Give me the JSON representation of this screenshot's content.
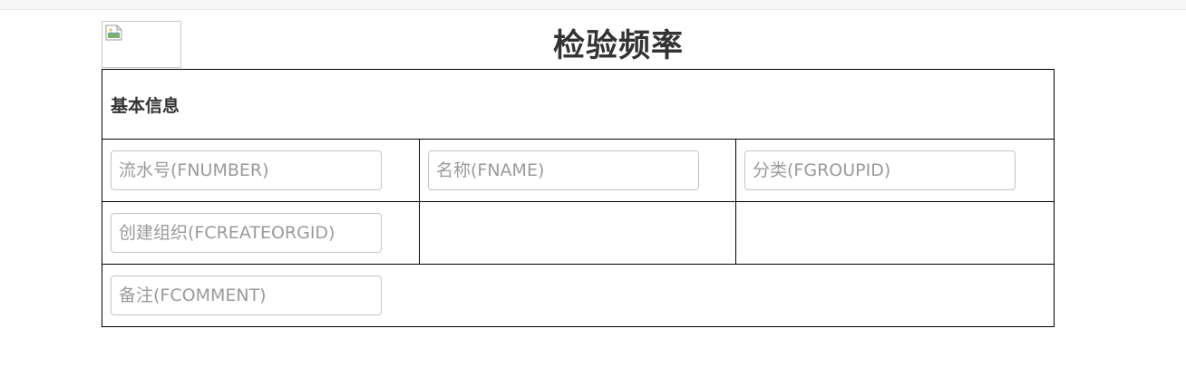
{
  "page": {
    "title": "检验频率"
  },
  "logo": {
    "icon": "broken-image-icon"
  },
  "section": {
    "title": "基本信息"
  },
  "fields": {
    "fnumber": {
      "placeholder": "流水号(FNUMBER)",
      "value": ""
    },
    "fname": {
      "placeholder": "名称(FNAME)",
      "value": ""
    },
    "fgroupid": {
      "placeholder": "分类(FGROUPID)",
      "value": ""
    },
    "fcreateorgid": {
      "placeholder": "创建组织(FCREATEORGID)",
      "value": ""
    },
    "fcomment": {
      "placeholder": "备注(FCOMMENT)",
      "value": ""
    }
  },
  "colors": {
    "border": "#000000",
    "input_border": "#c4c4c4",
    "placeholder": "#9a9a9a",
    "text": "#333333"
  }
}
